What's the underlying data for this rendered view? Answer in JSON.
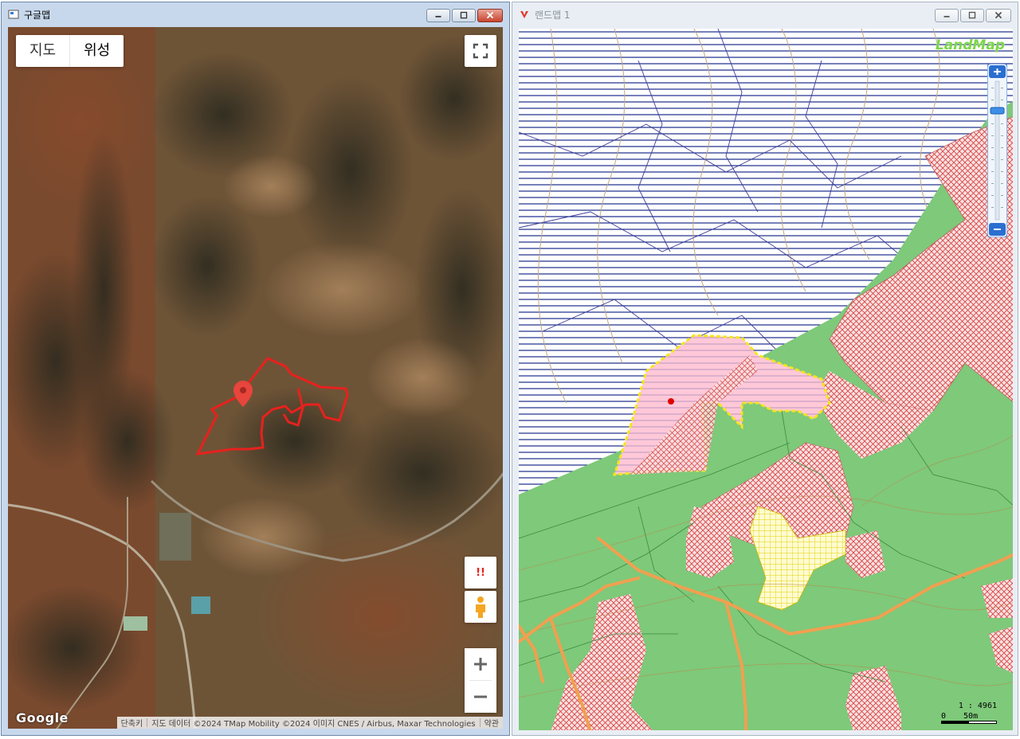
{
  "left_window": {
    "title": "구글맵",
    "map_type": {
      "map": "지도",
      "satellite": "위성"
    },
    "buttons": {
      "report_label": "!!"
    },
    "logo": "Google",
    "attribution": {
      "shortcuts": "단축키",
      "data": "지도 데이터 ©2024 TMap Mobility ©2024 이미지 CNES / Airbus, Maxar Technologies",
      "terms": "약관"
    },
    "accent_color": "#e8211d",
    "icons": [
      "fullscreen-icon",
      "map-pin-icon",
      "pegman-icon",
      "zoom-in-icon",
      "zoom-out-icon"
    ]
  },
  "right_window": {
    "title": "랜드맵 1",
    "logo": "LandMap",
    "scale_ratio": "1 : 4961",
    "scale_start": "0",
    "scale_length": "50m",
    "colors": {
      "forest": "#7ec97a",
      "water": "#000080",
      "parcel_border": "#f7e51a",
      "road": "#f0a050"
    }
  }
}
